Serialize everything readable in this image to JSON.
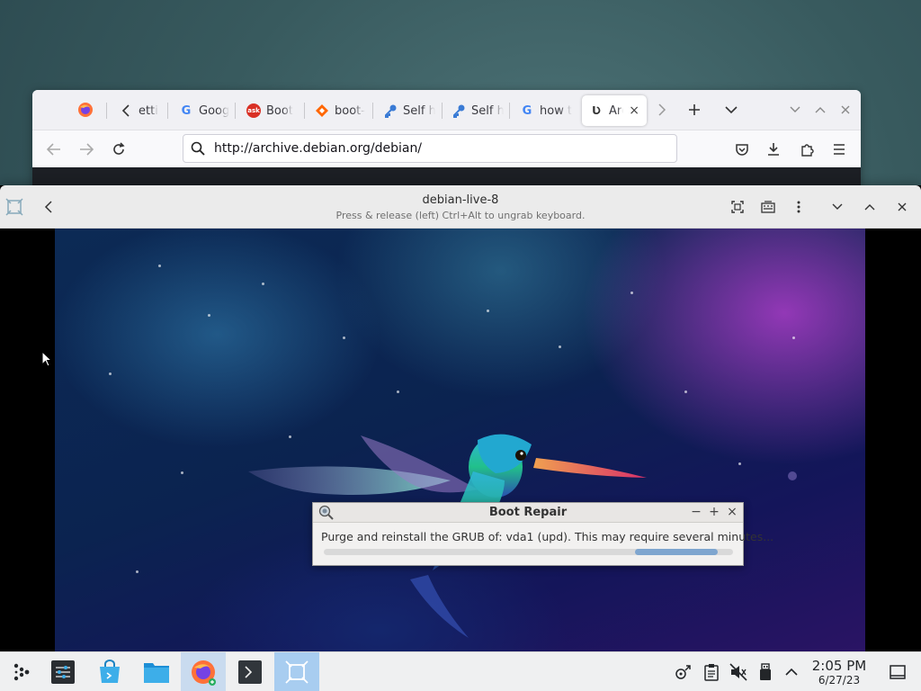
{
  "browser": {
    "url": "http://archive.debian.org/debian/",
    "tabs": [
      {
        "label": "etti",
        "icon": "back-arrow-icon"
      },
      {
        "label": "Goog",
        "icon": "google-icon"
      },
      {
        "label": "Boot",
        "icon": "ask-icon"
      },
      {
        "label": "boot-",
        "icon": "sourceforge-icon"
      },
      {
        "label": "Self h",
        "icon": "key-icon"
      },
      {
        "label": "Self h",
        "icon": "key-icon"
      },
      {
        "label": "how t",
        "icon": "google-icon"
      },
      {
        "label": "Arc",
        "icon": "ul-icon"
      }
    ],
    "ask_icon_text": "ask"
  },
  "vm": {
    "title": "debian-live-8",
    "subtitle": "Press & release (left) Ctrl+Alt to ungrab keyboard."
  },
  "dialog": {
    "title": "Boot Repair",
    "message": "Purge and reinstall the GRUB of: vda1 (upd). This may require several minutes...",
    "minimize": "−",
    "maximize": "+",
    "close": "×"
  },
  "taskbar": {
    "time": "2:05 PM",
    "date": "6/27/23"
  },
  "colors": {
    "taskbar_bg": "#eff0f1",
    "progress": "#7fa6cf",
    "selected_task": "#a8cdf0"
  }
}
